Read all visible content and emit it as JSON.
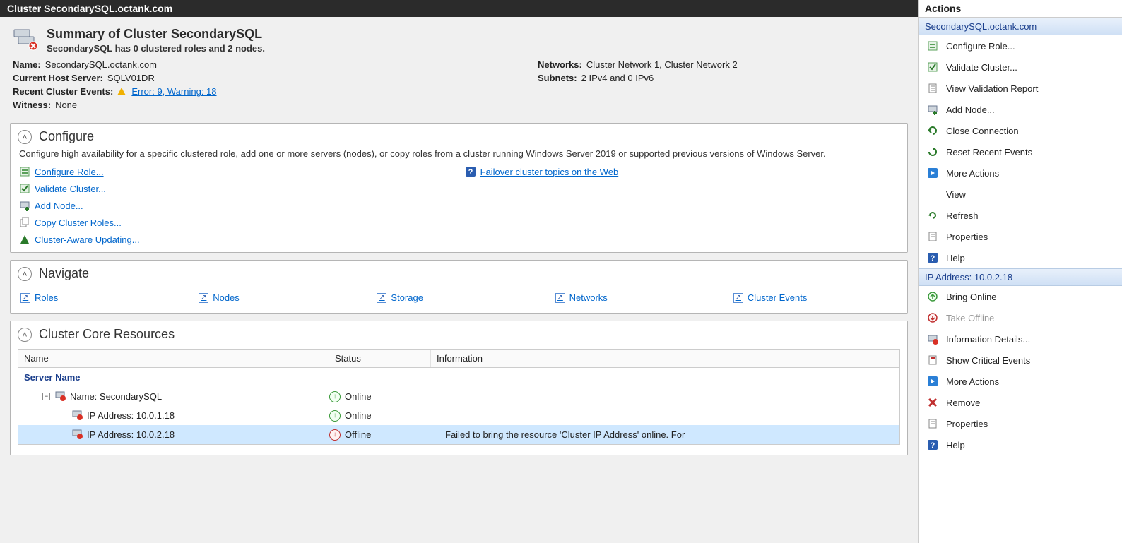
{
  "title": "Cluster SecondarySQL.octank.com",
  "summary": {
    "heading": "Summary of Cluster SecondarySQL",
    "subtitle": "SecondarySQL has 0 clustered roles and 2 nodes."
  },
  "info": {
    "name_label": "Name:",
    "name_value": "SecondarySQL.octank.com",
    "host_label": "Current Host Server:",
    "host_value": "SQLV01DR",
    "events_label": "Recent Cluster Events:",
    "events_link": "Error: 9, Warning: 18",
    "witness_label": "Witness:",
    "witness_value": "None",
    "networks_label": "Networks:",
    "networks_value": "Cluster Network 1, Cluster Network 2",
    "subnets_label": "Subnets:",
    "subnets_value": "2 IPv4 and 0 IPv6"
  },
  "configure": {
    "title": "Configure",
    "desc": "Configure high availability for a specific clustered role, add one or more servers (nodes), or copy roles from a cluster running Windows Server 2019 or supported previous versions of Windows Server.",
    "links_left": [
      "Configure Role...",
      "Validate Cluster...",
      "Add Node...",
      "Copy Cluster Roles...",
      "Cluster-Aware Updating..."
    ],
    "links_right": [
      "Failover cluster topics on the Web"
    ]
  },
  "navigate": {
    "title": "Navigate",
    "links": [
      "Roles",
      "Nodes",
      "Storage",
      "Networks",
      "Cluster Events"
    ]
  },
  "resources": {
    "title": "Cluster Core Resources",
    "cols": {
      "name": "Name",
      "status": "Status",
      "info": "Information"
    },
    "group_label": "Server Name",
    "rows": [
      {
        "indent": 1,
        "expand": "−",
        "name": "Name: SecondarySQL",
        "status": "Online",
        "status_ok": true,
        "info": "",
        "selected": false
      },
      {
        "indent": 2,
        "expand": "",
        "name": "IP Address: 10.0.1.18",
        "status": "Online",
        "status_ok": true,
        "info": "",
        "selected": false
      },
      {
        "indent": 2,
        "expand": "",
        "name": "IP Address: 10.0.2.18",
        "status": "Offline",
        "status_ok": false,
        "info": "Failed to bring the resource 'Cluster IP Address' online. For",
        "selected": true
      }
    ]
  },
  "actions": {
    "header": "Actions",
    "group1": {
      "title": "SecondarySQL.octank.com",
      "items": [
        {
          "label": "Configure Role...",
          "icon": "role",
          "enabled": true
        },
        {
          "label": "Validate Cluster...",
          "icon": "validate",
          "enabled": true
        },
        {
          "label": "View Validation Report",
          "icon": "report",
          "enabled": true
        },
        {
          "label": "Add Node...",
          "icon": "addnode",
          "enabled": true
        },
        {
          "label": "Close Connection",
          "icon": "close",
          "enabled": true
        },
        {
          "label": "Reset Recent Events",
          "icon": "reset",
          "enabled": true
        },
        {
          "label": "More Actions",
          "icon": "more",
          "enabled": true
        },
        {
          "label": "View",
          "icon": "",
          "enabled": true
        },
        {
          "label": "Refresh",
          "icon": "refresh",
          "enabled": true
        },
        {
          "label": "Properties",
          "icon": "props",
          "enabled": true
        },
        {
          "label": "Help",
          "icon": "help",
          "enabled": true
        }
      ]
    },
    "group2": {
      "title": "IP Address: 10.0.2.18",
      "items": [
        {
          "label": "Bring Online",
          "icon": "online",
          "enabled": true
        },
        {
          "label": "Take Offline",
          "icon": "offline",
          "enabled": false
        },
        {
          "label": "Information Details...",
          "icon": "info",
          "enabled": true
        },
        {
          "label": "Show Critical Events",
          "icon": "critical",
          "enabled": true
        },
        {
          "label": "More Actions",
          "icon": "more",
          "enabled": true
        },
        {
          "label": "Remove",
          "icon": "remove",
          "enabled": true
        },
        {
          "label": "Properties",
          "icon": "props",
          "enabled": true
        },
        {
          "label": "Help",
          "icon": "help",
          "enabled": true
        }
      ]
    }
  }
}
